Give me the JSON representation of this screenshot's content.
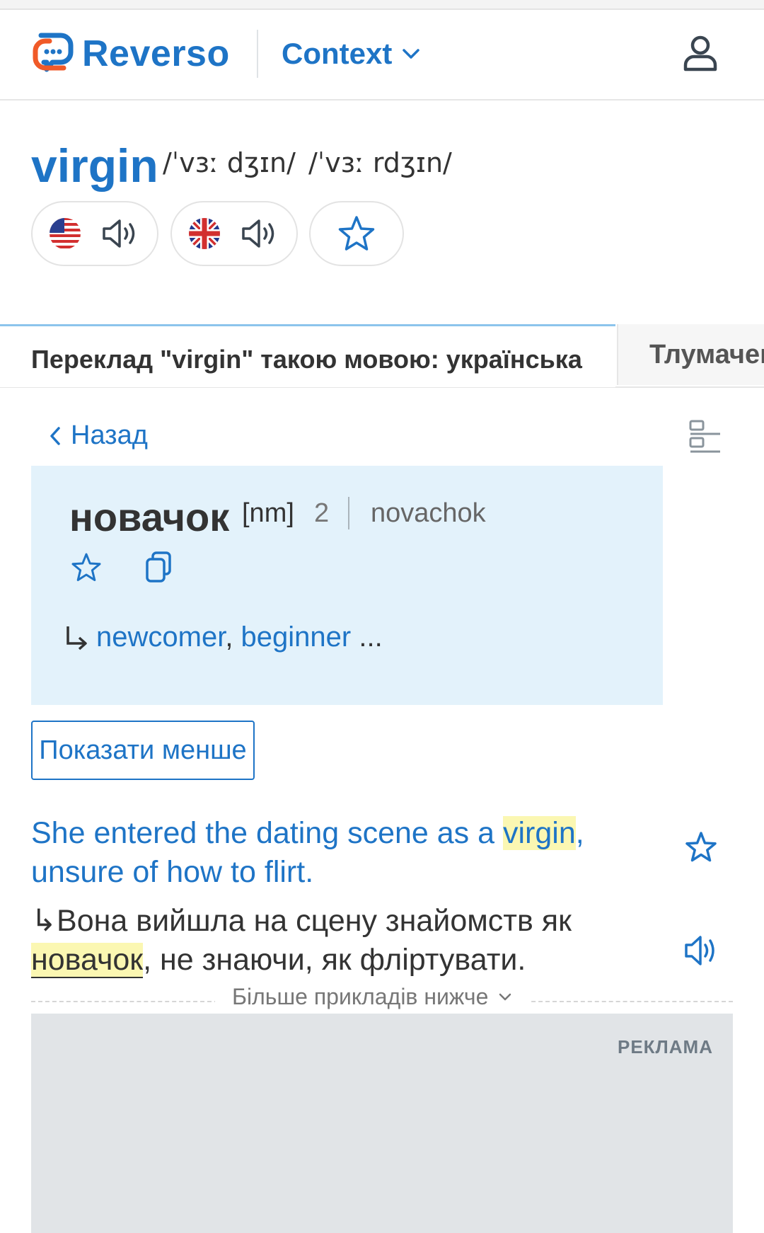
{
  "header": {
    "brand": "Reverso",
    "context_label": "Context"
  },
  "entry": {
    "word": "virgin",
    "ipa_us": "/ˈvɜː dʒɪn/",
    "ipa_uk": "/ˈvɜː rdʒɪn/"
  },
  "tabs": [
    {
      "label": "Переклад \"virgin\" такою мовою: українська"
    },
    {
      "label": "Тлумачення"
    }
  ],
  "back_label": "Назад",
  "translation": {
    "word": "новачок",
    "pos": "[nm]",
    "count": "2",
    "transliteration": "novachok",
    "synonyms": [
      "newcomer",
      "beginner"
    ],
    "ellipsis": "..."
  },
  "show_less_label": "Показати менше",
  "example": {
    "source_before": "She entered the dating scene as a ",
    "source_highlight": "virgin",
    "source_after": ", unsure of how to flirt.",
    "target_arrow": "↳",
    "target_before": "Вона вийшла на сцену знайомств як ",
    "target_highlight": "новачок",
    "target_after": ", не знаючи, як фліртувати."
  },
  "more_examples_label": "Більше прикладів нижче",
  "ad_label": "РЕКЛАМА",
  "colors": {
    "accent": "#1e74c6",
    "card_bg": "#e3f2fb",
    "highlight": "#fbf7b2",
    "ad_bg": "#e1e4e7"
  }
}
